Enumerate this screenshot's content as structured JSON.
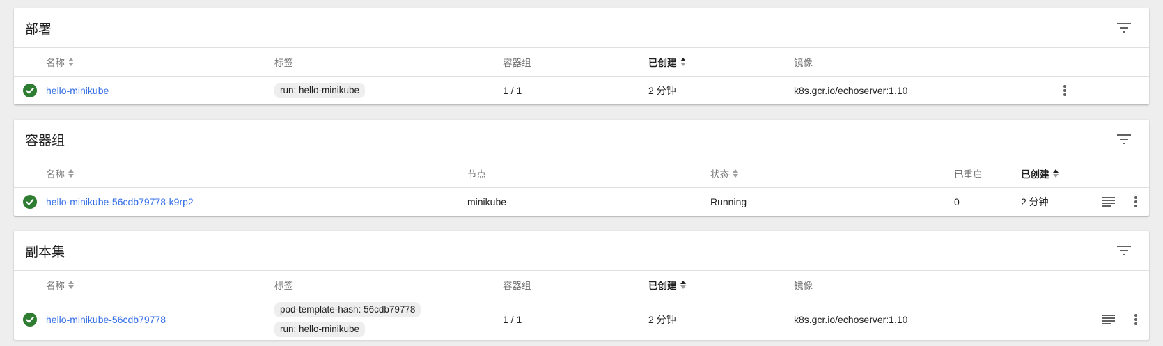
{
  "colors": {
    "accent": "#326de6",
    "status_ok": "#2e7d32"
  },
  "deployments": {
    "title": "部署",
    "headers": {
      "name": "名称",
      "labels": "标签",
      "pods": "容器组",
      "created": "已创建",
      "image": "镜像"
    },
    "rows": [
      {
        "name": "hello-minikube",
        "labels": [
          "run: hello-minikube"
        ],
        "pods": "1 / 1",
        "created": "2 分钟",
        "image": "k8s.gcr.io/echoserver:1.10"
      }
    ]
  },
  "pods": {
    "title": "容器组",
    "headers": {
      "name": "名称",
      "node": "节点",
      "status": "状态",
      "restarts": "已重启",
      "created": "已创建"
    },
    "rows": [
      {
        "name": "hello-minikube-56cdb79778-k9rp2",
        "node": "minikube",
        "status": "Running",
        "restarts": "0",
        "created": "2 分钟"
      }
    ]
  },
  "replicasets": {
    "title": "副本集",
    "headers": {
      "name": "名称",
      "labels": "标签",
      "pods": "容器组",
      "created": "已创建",
      "image": "镜像"
    },
    "rows": [
      {
        "name": "hello-minikube-56cdb79778",
        "labels": [
          "pod-template-hash: 56cdb79778",
          "run: hello-minikube"
        ],
        "pods": "1 / 1",
        "created": "2 分钟",
        "image": "k8s.gcr.io/echoserver:1.10"
      }
    ]
  }
}
